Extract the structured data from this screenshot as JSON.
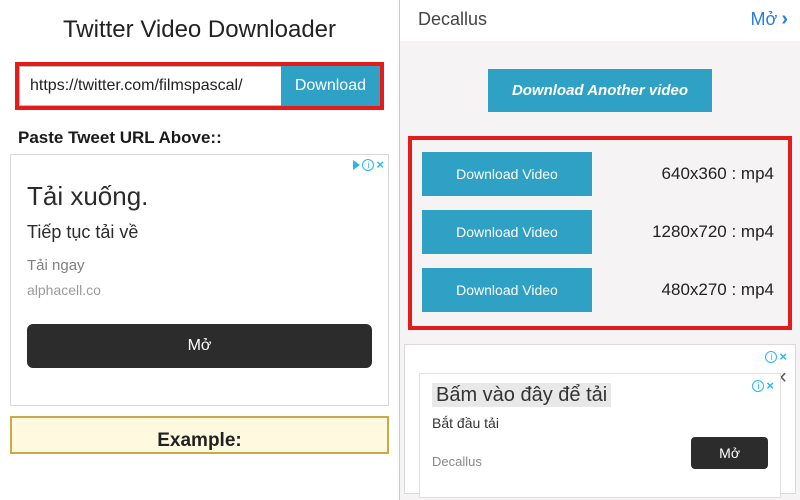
{
  "left": {
    "title": "Twitter Video Downloader",
    "url_value": "https://twitter.com/filmspascal/",
    "download_btn": "Download",
    "paste_label": "Paste Tweet URL Above::",
    "example_label": "Example:",
    "ad": {
      "heading": "Tải xuống.",
      "subheading": "Tiếp tục tải về",
      "line1": "Tải ngay",
      "domain": "alphacell.co",
      "open_btn": "Mở"
    }
  },
  "right": {
    "top_name": "Decallus",
    "top_action": "Mở",
    "another_btn": "Download Another video",
    "resolutions": [
      {
        "btn": "Download Video",
        "text": "640x360 : mp4"
      },
      {
        "btn": "Download Video",
        "text": "1280x720 : mp4"
      },
      {
        "btn": "Download Video",
        "text": "480x270 : mp4"
      }
    ],
    "ad": {
      "heading": "Bấm vào đây để tải",
      "sub": "Bắt đầu tải",
      "domain": "Decallus",
      "btn": "Mở"
    }
  }
}
